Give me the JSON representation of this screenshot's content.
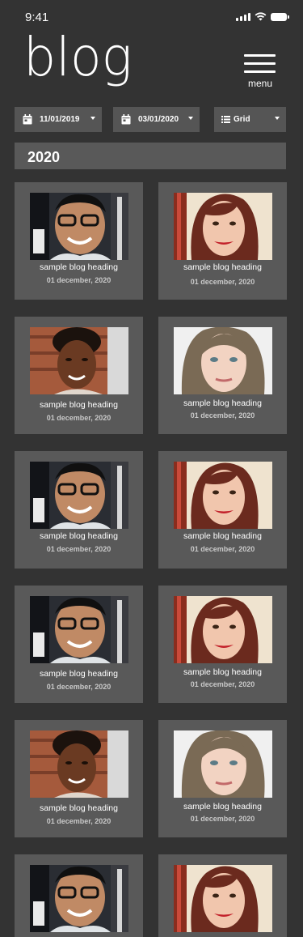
{
  "status": {
    "time": "9:41"
  },
  "header": {
    "brand": "blog",
    "menu_label": "menu"
  },
  "filters": {
    "start_date": "11/01/2019",
    "end_date": "03/01/2020",
    "view": "Grid"
  },
  "year": "2020",
  "posts": [
    {
      "heading": "sample blog heading",
      "date": "01 december, 2020",
      "photo": "man-glasses"
    },
    {
      "heading": "sample blog heading",
      "date": "01 december, 2020",
      "photo": "woman-red-hair"
    },
    {
      "heading": "sample blog heading",
      "date": "01 december, 2020",
      "photo": "woman-curly-hair"
    },
    {
      "heading": "sample blog heading",
      "date": "01 december, 2020",
      "photo": "woman-blonde"
    },
    {
      "heading": "sample blog heading",
      "date": "01 december, 2020",
      "photo": "man-glasses"
    },
    {
      "heading": "sample blog heading",
      "date": "01 december, 2020",
      "photo": "woman-red-hair"
    },
    {
      "heading": "sample blog heading",
      "date": "01 december, 2020",
      "photo": "man-glasses"
    },
    {
      "heading": "sample blog heading",
      "date": "01 december, 2020",
      "photo": "woman-red-hair"
    },
    {
      "heading": "sample blog heading",
      "date": "01 december, 2020",
      "photo": "woman-curly-hair"
    },
    {
      "heading": "sample blog heading",
      "date": "01 december, 2020",
      "photo": "woman-blonde"
    },
    {
      "heading": "",
      "date": "",
      "photo": "man-glasses"
    },
    {
      "heading": "",
      "date": "",
      "photo": "woman-red-hair"
    }
  ],
  "colors": {
    "background": "#333333",
    "card": "#595959",
    "filter": "#555555"
  }
}
